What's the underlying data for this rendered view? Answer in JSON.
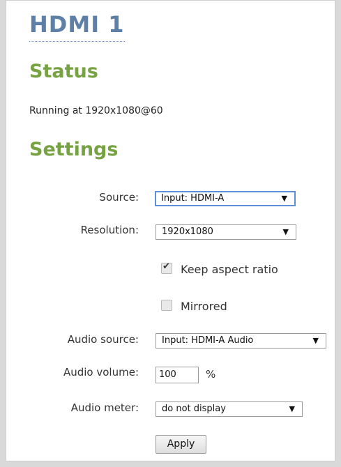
{
  "page": {
    "title": "HDMI 1",
    "status_heading": "Status",
    "status_text": "Running at 1920x1080@60",
    "settings_heading": "Settings"
  },
  "form": {
    "source": {
      "label": "Source:",
      "value": "Input: HDMI-A"
    },
    "resolution": {
      "label": "Resolution:",
      "value": "1920x1080"
    },
    "keep_aspect": {
      "label": "Keep aspect ratio",
      "checked": true
    },
    "mirrored": {
      "label": "Mirrored",
      "checked": false
    },
    "audio_source": {
      "label": "Audio source:",
      "value": "Input: HDMI-A Audio"
    },
    "audio_volume": {
      "label": "Audio volume:",
      "value": "100",
      "unit": "%"
    },
    "audio_meter": {
      "label": "Audio meter:",
      "value": "do not display"
    },
    "apply_label": "Apply"
  },
  "icons": {
    "dropdown": "caret-down-icon",
    "check": "checkmark-icon"
  },
  "colors": {
    "title": "#5e7fa6",
    "heading": "#77a242",
    "focus_border": "#5b8fd6"
  }
}
